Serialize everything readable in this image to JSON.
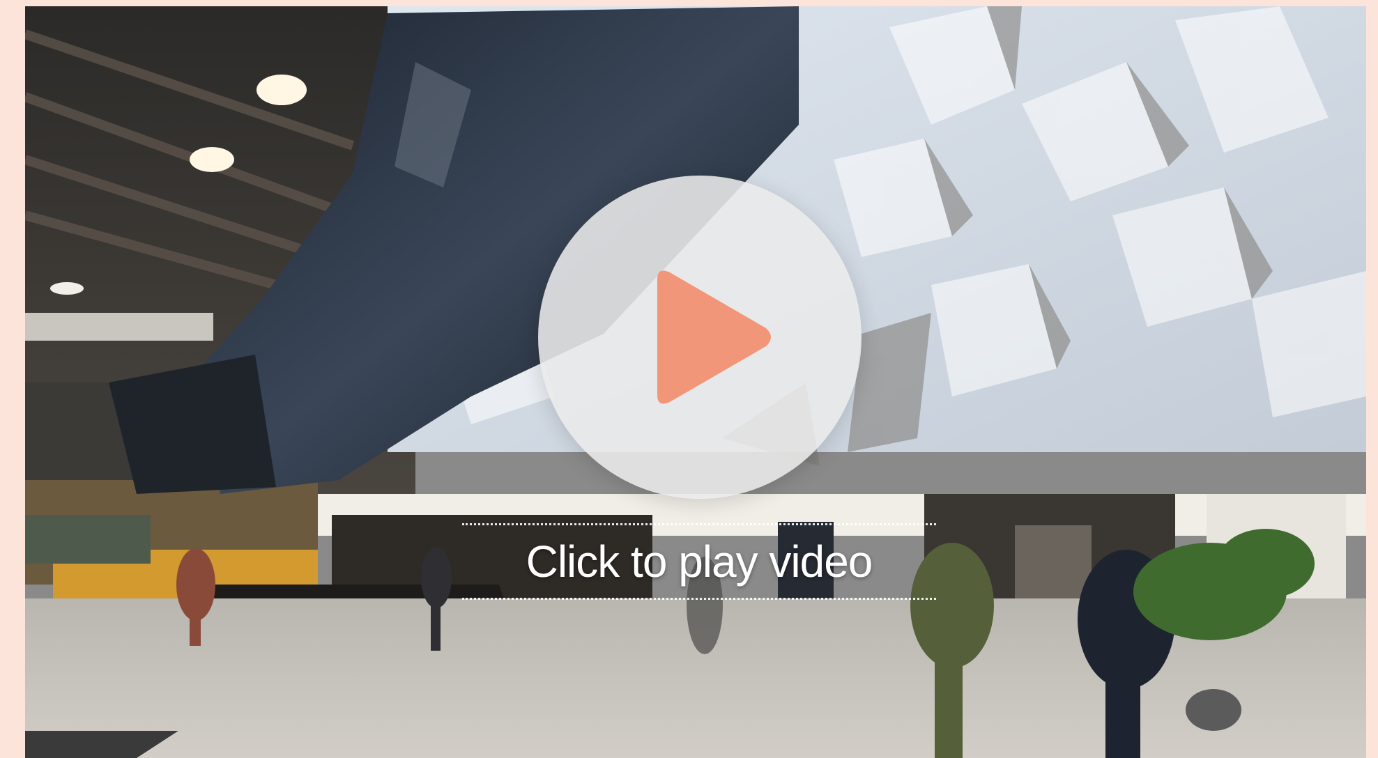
{
  "video": {
    "caption": "Click to play video",
    "play_icon": "play-icon",
    "colors": {
      "page_background": "#fde4da",
      "play_triangle": "#f2967a",
      "play_circle": "#ebebeb",
      "caption_text": "#ffffff"
    }
  }
}
